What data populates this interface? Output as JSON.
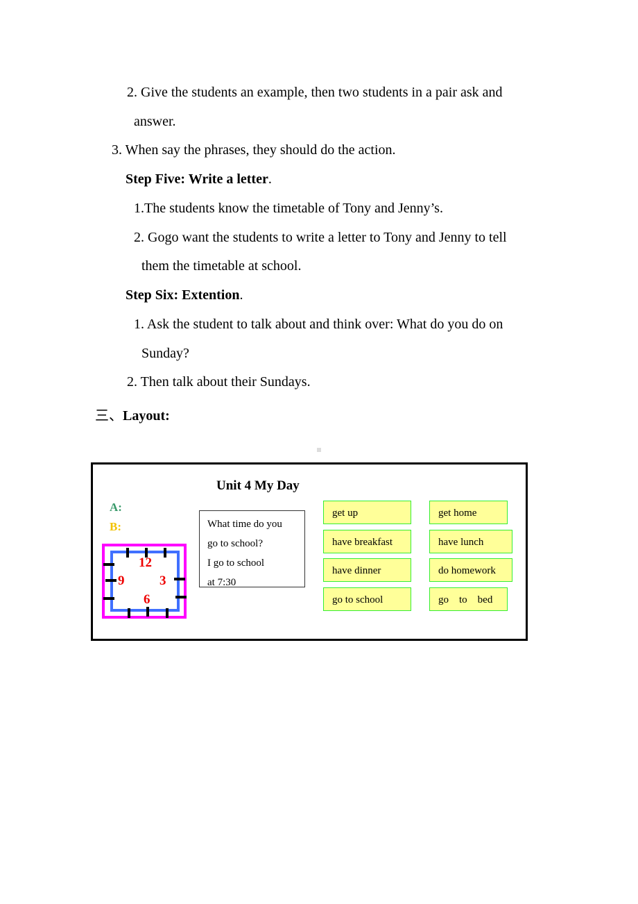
{
  "document": {
    "lines": [
      "2. Give the students an example, then two students in a pair ask and",
      "answer.",
      "3. When say the phrases, they should do the action.",
      "1.The students know the timetable of Tony and Jenny’s.",
      "2. Gogo want the students to write a letter to Tony and Jenny to tell",
      "them the timetable at school.",
      "1. Ask the student to talk about and think over: What do you do on",
      "Sunday?",
      "2. Then talk about their Sundays."
    ],
    "step_five": {
      "heading": "Step Five: Write a letter",
      "suffix": "."
    },
    "step_six": {
      "heading": "Step Six: Extention",
      "suffix": "."
    },
    "section": {
      "prefix": "三、",
      "heading": "Layout:"
    }
  },
  "layout_board": {
    "title": "Unit 4 My Day",
    "label_a": "A:",
    "label_b": "B:",
    "colors": {
      "a": "#3a9a6b",
      "b": "#f2c200",
      "phrase_bg": "#ffff99",
      "phrase_border": "#33ee33",
      "clock_outer": "#ff00ff",
      "clock_inner": "#4070ff",
      "clock_numbers": "#ee0000"
    },
    "dialog": [
      "What time do you",
      "go to school?",
      "I go to school",
      "at 7:30"
    ],
    "clock_numbers": [
      "12",
      "3",
      "6",
      "9"
    ],
    "phrases_left": [
      "get up",
      "have breakfast",
      "have dinner",
      "go to school"
    ],
    "phrases_right": [
      "get home",
      "have lunch",
      "do homework",
      "go    to    bed"
    ]
  }
}
